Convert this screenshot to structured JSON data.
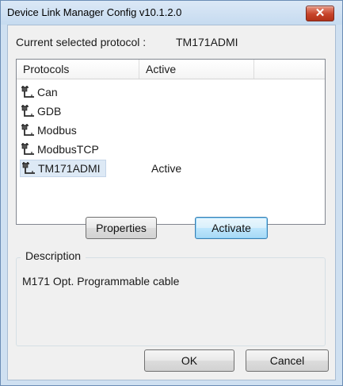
{
  "window": {
    "title": "Device Link Manager Config v10.1.2.0"
  },
  "current": {
    "label": "Current selected protocol :",
    "value": "TM171ADMI"
  },
  "list": {
    "headers": [
      "Protocols",
      "Active"
    ],
    "rows": [
      {
        "name": "Can",
        "active": ""
      },
      {
        "name": "GDB",
        "active": ""
      },
      {
        "name": "Modbus",
        "active": ""
      },
      {
        "name": "ModbusTCP",
        "active": ""
      },
      {
        "name": "TM171ADMI",
        "active": "Active",
        "selected": true
      }
    ]
  },
  "buttons": {
    "properties": "Properties",
    "activate": "Activate",
    "ok": "OK",
    "cancel": "Cancel"
  },
  "description": {
    "label": "Description",
    "text": "M171 Opt. Programmable cable"
  },
  "icons": {
    "close": "close-icon",
    "protocol": "cable-plug-icon"
  },
  "colors": {
    "close_button": "#c7432a",
    "selection": "#dde9f5",
    "default_button_border": "#3c7fb1"
  }
}
